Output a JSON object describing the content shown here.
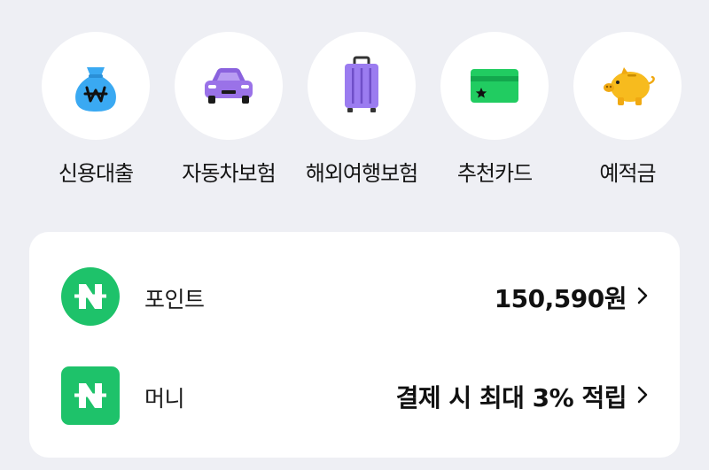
{
  "services": [
    {
      "label": "신용대출",
      "icon": "money-bag-icon"
    },
    {
      "label": "자동차보험",
      "icon": "car-icon"
    },
    {
      "label": "해외여행보험",
      "icon": "suitcase-icon"
    },
    {
      "label": "추천카드",
      "icon": "card-icon"
    },
    {
      "label": "예적금",
      "icon": "piggy-bank-icon"
    }
  ],
  "points": {
    "label": "포인트",
    "value": "150,590원"
  },
  "money": {
    "label": "머니",
    "value": "결제 시 최대 3% 적립"
  },
  "colors": {
    "background": "#eeeff4",
    "brand_green": "#1ec26a",
    "bag_blue": "#3aa9f2",
    "car_purple": "#9a72e8",
    "suitcase_purple": "#9b7cf0",
    "card_green": "#21cc61",
    "piggy_yellow": "#f7bb1e"
  }
}
